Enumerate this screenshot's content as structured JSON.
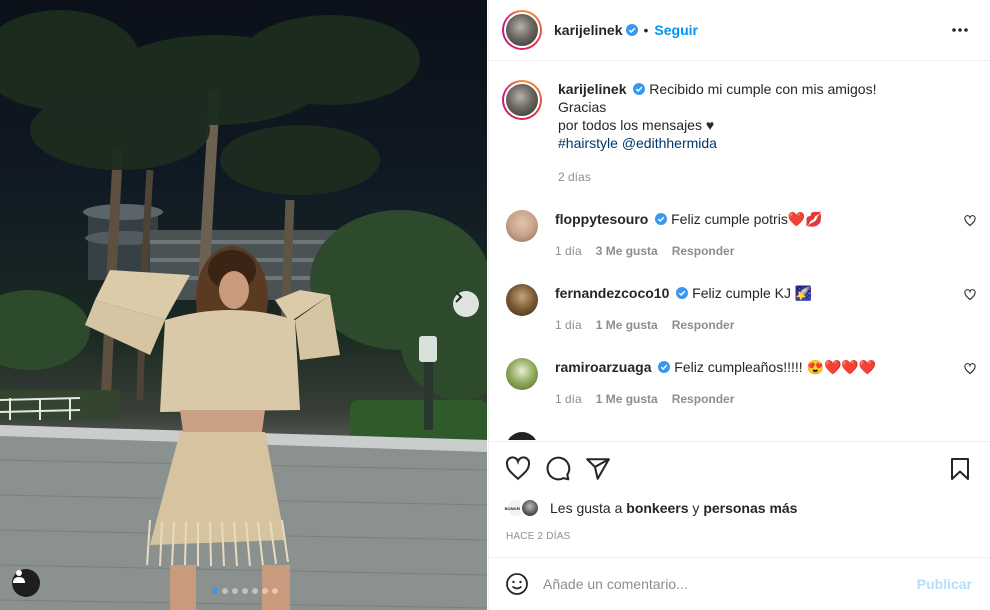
{
  "post": {
    "author": "karijelinek",
    "follow_label": "Seguir",
    "separator": "•",
    "caption": {
      "line1": "Recibido mi cumple con mis amigos!",
      "line2": "Gracias",
      "line3": "por todos los mensajes ♥",
      "hashtag": "#hairstyle",
      "mention": "@edithhermida",
      "time": "2 días"
    },
    "image_dots_count": 7
  },
  "comments": [
    {
      "user": "floppytesouro",
      "text": "Feliz cumple potris❤️💋",
      "time": "1 día",
      "likes": "3 Me gusta",
      "reply": "Responder",
      "avatar_color": "#c9a38a"
    },
    {
      "user": "fernandezcoco10",
      "text": "Feliz cumple KJ 🌠",
      "time": "1 día",
      "likes": "1 Me gusta",
      "reply": "Responder",
      "avatar_color": "#7a5a34"
    },
    {
      "user": "ramiroarzuaga",
      "text": "Feliz cumpleaños!!!!! 😍❤️❤️❤️",
      "time": "1 día",
      "likes": "1 Me gusta",
      "reply": "Responder",
      "avatar_color": "#8fa85c"
    }
  ],
  "likes": {
    "prefix": "Les gusta a",
    "user": "bonkeers",
    "conj": "y",
    "others": "personas más",
    "mini_avatar_text": "BONKEERS"
  },
  "timestamp": "HACE 2 DÍAS",
  "composer": {
    "placeholder": "Añade un comentario...",
    "publish_label": "Publicar"
  },
  "colors": {
    "accent": "#0095f6",
    "verified": "#3897f0",
    "link": "#00376b",
    "publish_disabled": "#b2dffc"
  },
  "icons": [
    "more-icon",
    "heart-icon",
    "comment-icon",
    "share-icon",
    "save-icon",
    "emoji-icon",
    "chevron-right-icon",
    "user-tag-icon",
    "verified-icon"
  ]
}
